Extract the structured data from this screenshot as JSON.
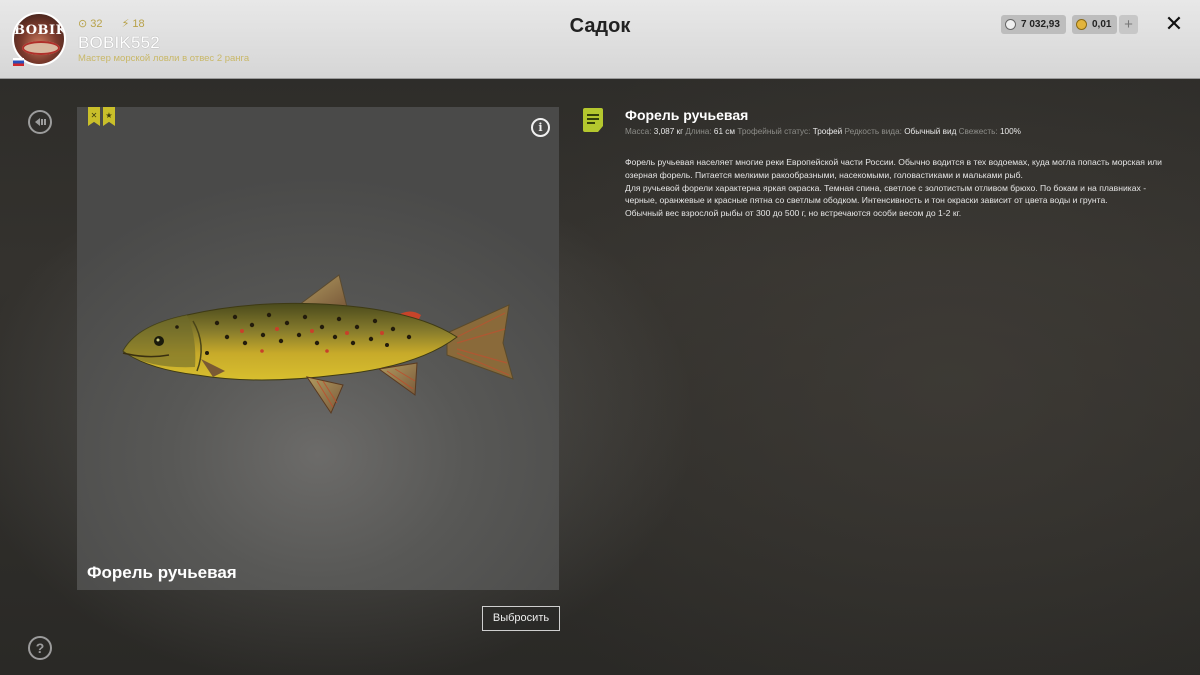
{
  "header": {
    "title": "Садок",
    "user": {
      "avatar_text": "BOBIK",
      "name": "BOBIK552",
      "rank": "Мастер морской ловли в отвес 2 ранга",
      "stat_level": "32",
      "stat_energy": "18"
    },
    "currency": {
      "silver": "7 032,93",
      "gold": "0,01",
      "add_label": "+"
    },
    "close_label": "✕"
  },
  "sidebar": {
    "back_icon": "back-icon",
    "help_label": "?"
  },
  "fish_card": {
    "caption": "Форель ручьевая",
    "info_label": "i",
    "badge_count": 2
  },
  "discard_button": "Выбросить",
  "details": {
    "name": "Форель ручьевая",
    "mass_label": "Масса:",
    "mass_value": "3,087 кг",
    "length_label": "Длина:",
    "length_value": "61 см",
    "trophy_label": "Трофейный статус:",
    "trophy_value": "Трофей",
    "rarity_label": "Редкость вида:",
    "rarity_value": "Обычный вид",
    "fresh_label": "Свежесть:",
    "fresh_value": "100%",
    "description_1": "Форель ручьевая населяет многие реки Европейской части России. Обычно водится в тех водоемах, куда могла попасть морская или озерная форель. Питается мелкими ракообразными, насекомыми, головастиками и мальками рыб.",
    "description_2": "Для ручьевой форели характерна яркая окраска. Темная спина, светлое с золотистым отливом брюхо. По бокам и на плавниках - черные, оранжевые и красные пятна со светлым ободком. Интенсивность и тон окраски зависит от цвета воды и грунта.",
    "description_3": "Обычный вес взрослой рыбы от 300 до 500 г, но встречаются особи весом до 1-2 кг."
  },
  "colors": {
    "accent_yellow": "#c9bf2a",
    "note_green": "#b4c72e"
  }
}
